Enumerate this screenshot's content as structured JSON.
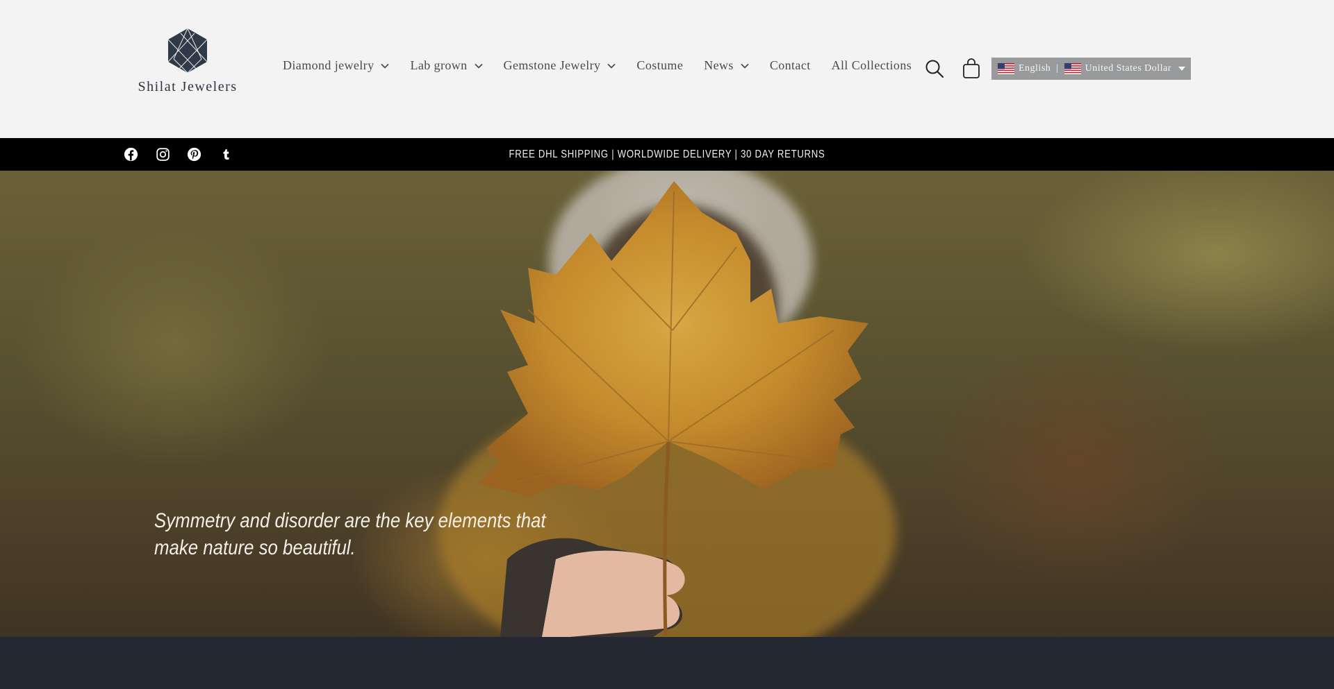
{
  "brand": {
    "name": "Shilat Jewelers",
    "logo_icon": "hexagon-gem-icon",
    "logo_color": "#2f3a48"
  },
  "nav": {
    "items": [
      {
        "label": "Diamond jewelry",
        "has_dropdown": true
      },
      {
        "label": "Lab grown",
        "has_dropdown": true
      },
      {
        "label": "Gemstone Jewelry",
        "has_dropdown": true
      },
      {
        "label": "Costume",
        "has_dropdown": false
      },
      {
        "label": "News",
        "has_dropdown": true
      },
      {
        "label": "Contact",
        "has_dropdown": false
      },
      {
        "label": "All Collections",
        "has_dropdown": false
      }
    ]
  },
  "header_icons": {
    "search": "search-icon",
    "cart": "cart-icon"
  },
  "switcher": {
    "language": "English",
    "currency": "United States Dollar",
    "separator": "|",
    "flag": "us-flag-icon",
    "background": "#999a9b"
  },
  "announcement": {
    "text": "FREE DHL SHIPPING | WORLDWIDE DELIVERY | 30 DAY RETURNS",
    "background": "#000000",
    "social": [
      "facebook-icon",
      "instagram-icon",
      "pinterest-icon",
      "tumblr-icon"
    ]
  },
  "hero": {
    "quote": "Symmetry and disorder are the key elements that make nature so beautiful.",
    "image": "maple-leaf-photo"
  },
  "colors": {
    "header_bg": "#f3f3f3",
    "footer_bg": "#242833"
  }
}
